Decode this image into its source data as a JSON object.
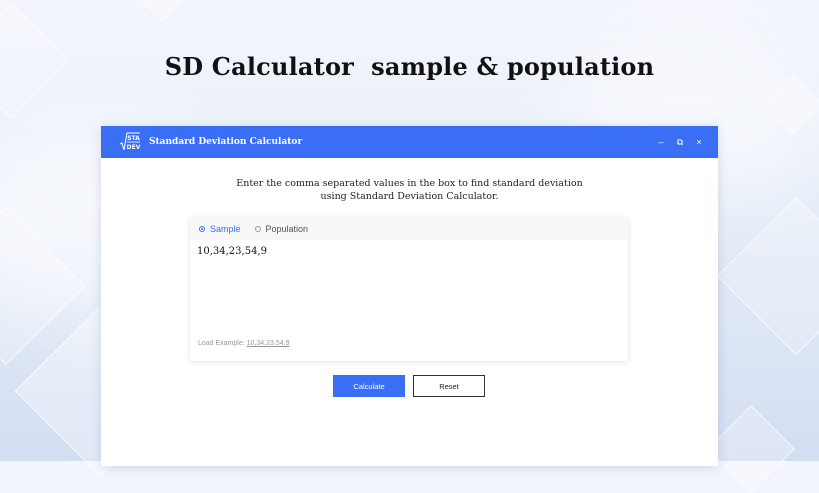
{
  "page": {
    "headline": "SD Calculator  sample & population"
  },
  "window": {
    "title": "Standard Deviation Calculator",
    "logo_text": [
      "STA",
      "DEV"
    ],
    "controls": {
      "minimize": "–",
      "restore": "⧉",
      "close": "×"
    }
  },
  "instructions": {
    "line1": "Enter the comma separated values in the box to find standard deviation",
    "line2": "using Standard Deviation Calculator."
  },
  "calculator": {
    "options": [
      {
        "label": "Sample",
        "selected": true
      },
      {
        "label": "Population",
        "selected": false
      }
    ],
    "input_value": "10,34,23,54,9",
    "example_label": "Load Example:",
    "example_value": "10,34,23,54,9"
  },
  "buttons": {
    "calculate": "Calculate",
    "reset": "Reset"
  },
  "colors": {
    "accent": "#3a6ef5"
  }
}
